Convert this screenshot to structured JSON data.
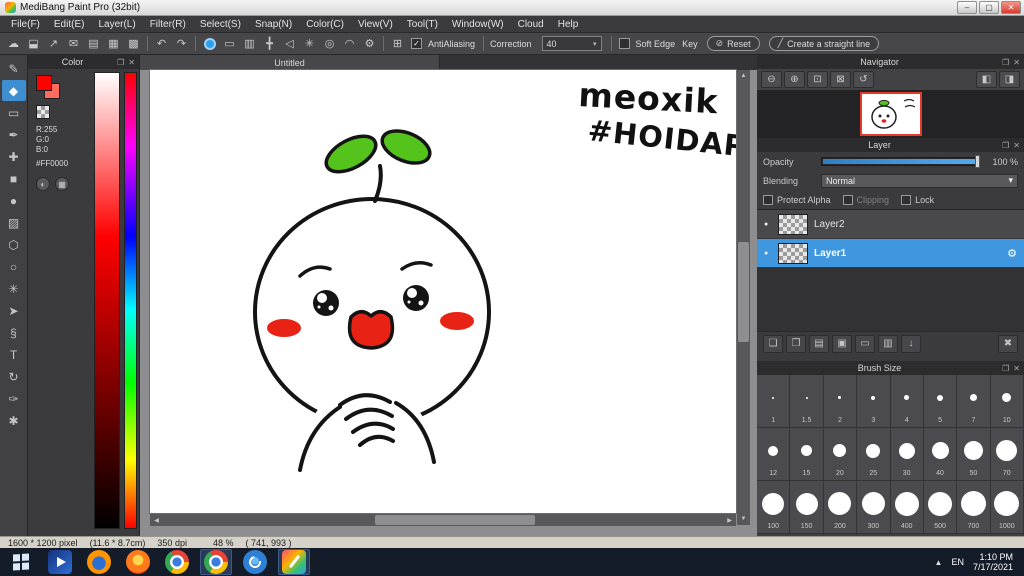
{
  "window": {
    "title": "MediBang Paint Pro (32bit)"
  },
  "menu": {
    "items": [
      "File(F)",
      "Edit(E)",
      "Layer(L)",
      "Filter(R)",
      "Select(S)",
      "Snap(N)",
      "Color(C)",
      "View(V)",
      "Tool(T)",
      "Window(W)",
      "Cloud",
      "Help"
    ]
  },
  "toolbar": {
    "antialiasing_label": "AntiAliasing",
    "correction_label": "Correction",
    "correction_value": "40",
    "soft_edge_label": "Soft Edge",
    "key_label": "Key",
    "reset_label": "Reset",
    "straight_line_label": "Create a straight line"
  },
  "icons": {
    "minimize": "–",
    "maximize": "▢",
    "close": "✕",
    "popout": "❐",
    "panel_close": "✕",
    "cloud": "☁",
    "save": "⬓",
    "publish": "↗",
    "chat": "✉",
    "document": "▤",
    "grid": "▦",
    "material": "▩",
    "undo": "↶",
    "redo": "↷",
    "snap_off": "▭",
    "snap_parallel": "▥",
    "snap_cross": "╋",
    "snap_vanish": "◁",
    "snap_radial": "✳",
    "snap_circle": "◎",
    "snap_curve": "◠",
    "snap_settings": "⚙",
    "grid_toggle": "⊞",
    "dropdown_arrow": "▾",
    "check": "✓",
    "reset_icon": "⊘",
    "line_icon": "╱",
    "zoom_out": "⊖",
    "zoom_in": "⊕",
    "zoom_fit": "⊡",
    "zoom_actual": "⊠",
    "zoom_reset": "↺",
    "nav_prev": "◧",
    "nav_next": "◨",
    "visibility_dot": "●",
    "gear": "⚙",
    "layer_new": "❏",
    "layer_duplicate": "❐",
    "layer_property": "▤",
    "folder_new": "▣",
    "folder": "▭",
    "layer_transfer": "▥",
    "merge_down": "↓",
    "layer_delete": "✖",
    "scroll_up": "▲",
    "scroll_down": "▼",
    "scroll_left": "◀",
    "scroll_right": "▶",
    "tray_expand": "▲",
    "swap_color": "◐",
    "palette_grid": "▦"
  },
  "tools": [
    {
      "name": "brush",
      "glyph": "✎"
    },
    {
      "name": "eraser",
      "glyph": "◆"
    },
    {
      "name": "marquee",
      "glyph": "▭"
    },
    {
      "name": "pen",
      "glyph": "✒"
    },
    {
      "name": "move",
      "glyph": "✚"
    },
    {
      "name": "shape",
      "glyph": "■"
    },
    {
      "name": "bucket",
      "glyph": "●"
    },
    {
      "name": "gradient",
      "glyph": "▨"
    },
    {
      "name": "lasso",
      "glyph": "⬡"
    },
    {
      "name": "ellipse-select",
      "glyph": "○"
    },
    {
      "name": "magic-wand",
      "glyph": "✳"
    },
    {
      "name": "select-pen",
      "glyph": "➤"
    },
    {
      "name": "operation",
      "glyph": "§"
    },
    {
      "name": "text",
      "glyph": "T"
    },
    {
      "name": "rotate",
      "glyph": "↻"
    },
    {
      "name": "eyedropper",
      "glyph": "✑"
    },
    {
      "name": "hand",
      "glyph": "✱"
    }
  ],
  "color_panel": {
    "title": "Color",
    "r": "R:255",
    "g": "G:0",
    "b": "B:0",
    "hex": "#FF0000"
  },
  "canvas": {
    "tab": "Untitled",
    "annotation_line1": "meoxik",
    "annotation_line2": "#HOIDAP"
  },
  "navigator": {
    "title": "Navigator"
  },
  "layer_panel": {
    "title": "Layer",
    "opacity_label": "Opacity",
    "opacity_value": "100 %",
    "blending_label": "Blending",
    "blending_value": "Normal",
    "protect_alpha_label": "Protect Alpha",
    "clipping_label": "Clipping",
    "lock_label": "Lock",
    "layers": [
      {
        "name": "Layer2",
        "selected": false
      },
      {
        "name": "Layer1",
        "selected": true
      }
    ]
  },
  "brush_panel": {
    "title": "Brush Size",
    "sizes": [
      "1",
      "1.5",
      "2",
      "3",
      "4",
      "5",
      "7",
      "10",
      "12",
      "15",
      "20",
      "25",
      "30",
      "40",
      "50",
      "70",
      "100",
      "150",
      "200",
      "300",
      "400",
      "500",
      "700",
      "1000"
    ]
  },
  "status_bar": {
    "dimensions": "1600 * 1200 pixel",
    "physical": "(11.6 * 8.7cm)",
    "dpi": "350 dpi",
    "zoom": "48 %",
    "cursor": "( 741, 993 )"
  },
  "taskbar": {
    "language": "EN",
    "time": "1:10 PM",
    "date": "7/17/2021"
  },
  "colors": {
    "accent": "#3d8fd1",
    "selection": "#3f97e0",
    "foreground": "#ff0000",
    "leaf_green": "#54c41c",
    "blush_red": "#e82315"
  }
}
